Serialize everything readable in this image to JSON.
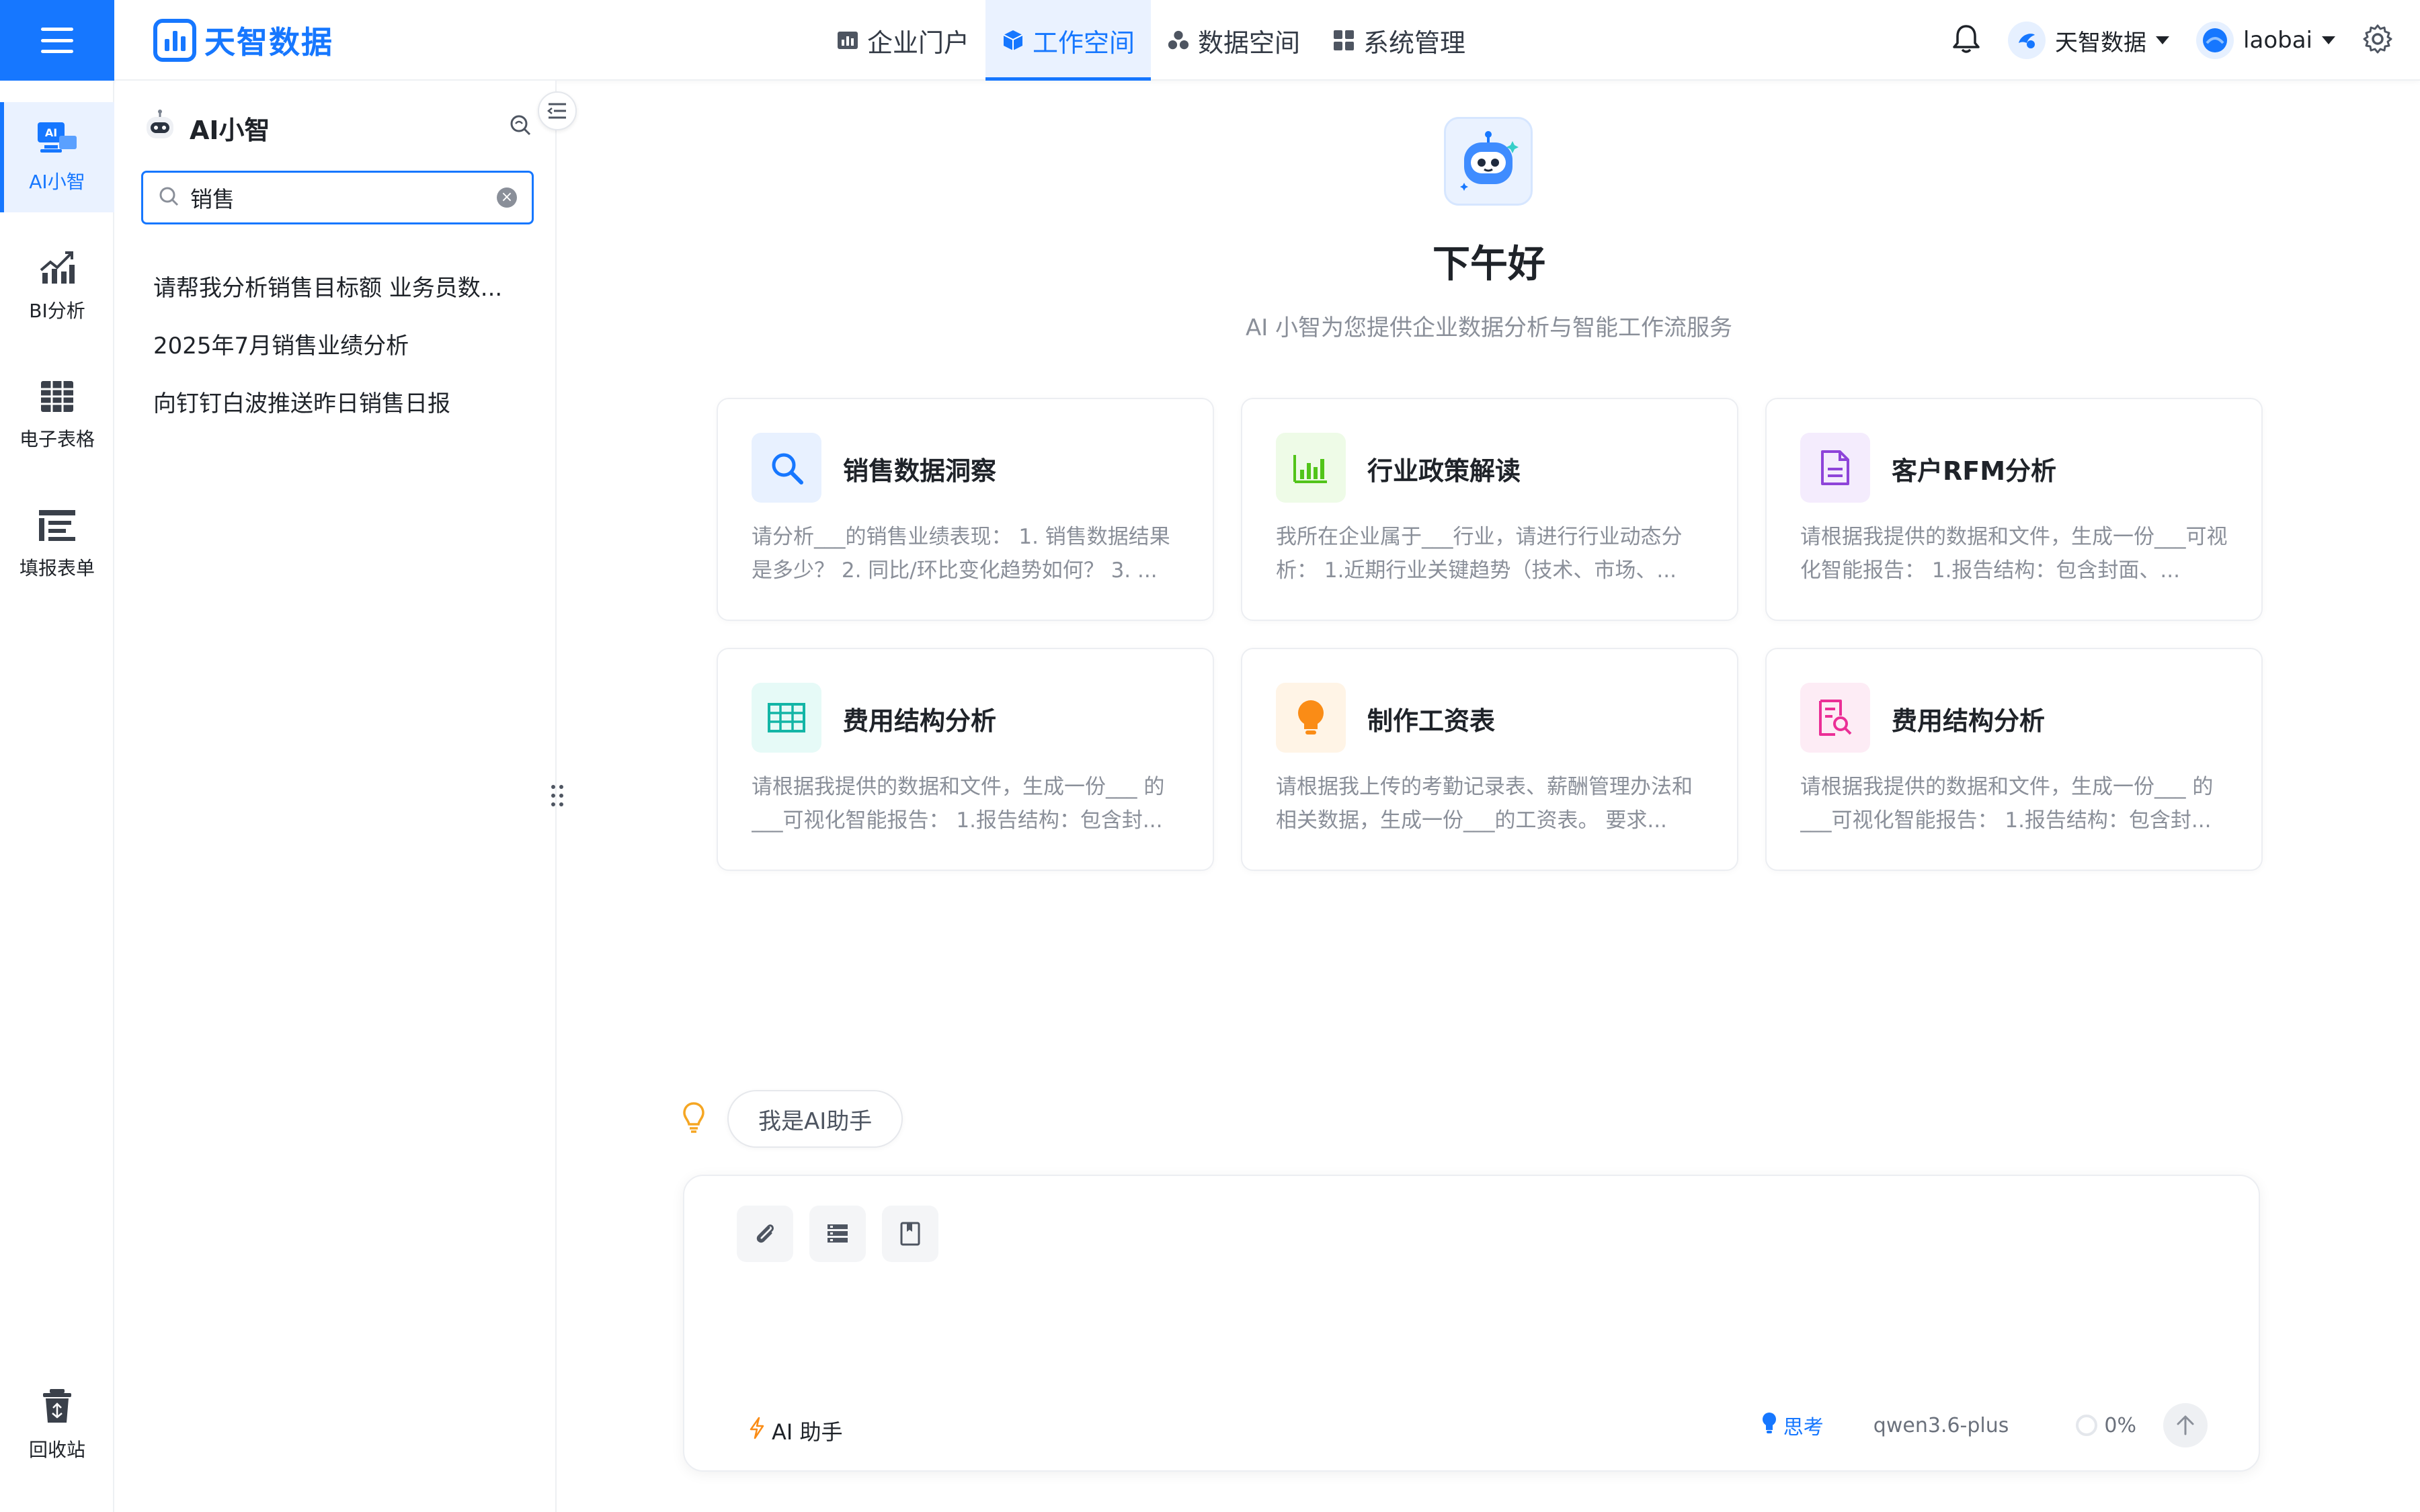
{
  "brand": {
    "name": "天智数据",
    "color": "#1677ff"
  },
  "topnav": {
    "items": [
      {
        "label": "企业门户",
        "icon": "bar-chart-icon",
        "active": false
      },
      {
        "label": "工作空间",
        "icon": "cube-icon",
        "active": true
      },
      {
        "label": "数据空间",
        "icon": "cluster-icon",
        "active": false
      },
      {
        "label": "系统管理",
        "icon": "grid-icon",
        "active": false
      }
    ]
  },
  "topright": {
    "org": "天智数据",
    "user": "laobai"
  },
  "rail": {
    "items": [
      {
        "label": "AI小智",
        "icon": "ai-icon",
        "active": true
      },
      {
        "label": "BI分析",
        "icon": "bi-chart-icon",
        "active": false
      },
      {
        "label": "电子表格",
        "icon": "spreadsheet-icon",
        "active": false
      },
      {
        "label": "填报表单",
        "icon": "form-icon",
        "active": false
      }
    ],
    "bottom": {
      "label": "回收站",
      "icon": "recycle-icon"
    }
  },
  "panel": {
    "title": "AI小智",
    "search_value": "销售",
    "history": [
      "请帮我分析销售目标额 业务员数...",
      "2025年7月销售业绩分析",
      "向钉钉白波推送昨日销售日报"
    ]
  },
  "main": {
    "greeting": "下午好",
    "subtitle": "AI 小智为您提供企业数据分析与智能工作流服务",
    "cards": [
      {
        "title": "销售数据洞察",
        "desc": "请分析___的销售业绩表现： 1. 销售数据结果是多少？ 2. 同比/环比变化趋势如何？ 3. ...",
        "icon": "search-icon",
        "color": "#1677ff",
        "bg": "#e8f1ff"
      },
      {
        "title": "行业政策解读",
        "desc": "我所在企业属于___行业，请进行行业动态分析： 1.近期行业关键趋势（技术、市场、...",
        "icon": "bar-chart-icon",
        "color": "#52c41a",
        "bg": "#eefbe7"
      },
      {
        "title": "客户RFM分析",
        "desc": "请根据我提供的数据和文件，生成一份___可视化智能报告： 1.报告结构：包含封面、...",
        "icon": "document-icon",
        "color": "#8e44d9",
        "bg": "#f4ecfd"
      },
      {
        "title": "费用结构分析",
        "desc": "请根据我提供的数据和文件，生成一份___ 的___可视化智能报告： 1.报告结构：包含封...",
        "icon": "table-icon",
        "color": "#13b5a6",
        "bg": "#e6faf7"
      },
      {
        "title": "制作工资表",
        "desc": "请根据我上传的考勤记录表、薪酬管理办法和相关数据，生成一份___的工资表。 要求...",
        "icon": "bulb-icon",
        "color": "#fa8c16",
        "bg": "#fff4e6"
      },
      {
        "title": "费用结构分析",
        "desc": "请根据我提供的数据和文件，生成一份___ 的___可视化智能报告： 1.报告结构：包含封...",
        "icon": "doc-search-icon",
        "color": "#eb2f96",
        "bg": "#fdecf5"
      }
    ],
    "hint_chip": "我是AI助手",
    "composer": {
      "placeholder": "",
      "mode_label": "AI 助手",
      "think_label": "思考",
      "model": "qwen3.6-plus",
      "progress_label": "0%",
      "progress": 0
    }
  }
}
